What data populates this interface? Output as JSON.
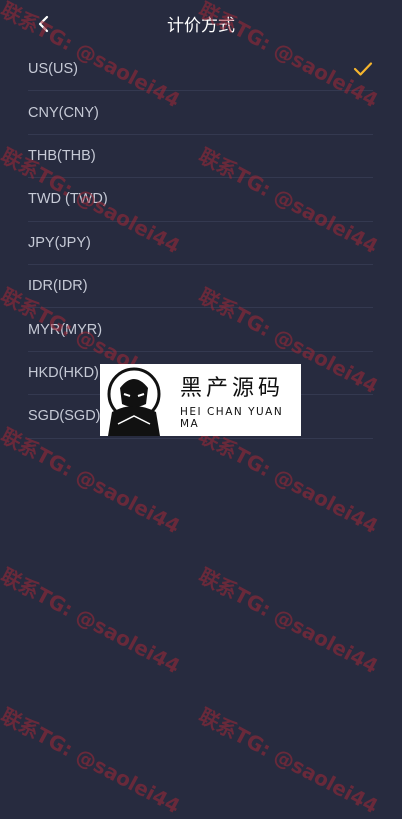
{
  "header": {
    "title": "计价方式"
  },
  "currencies": [
    {
      "label": "US(US)",
      "selected": true
    },
    {
      "label": "CNY(CNY)",
      "selected": false
    },
    {
      "label": "THB(THB)",
      "selected": false
    },
    {
      "label": "TWD (TWD)",
      "selected": false
    },
    {
      "label": "JPY(JPY)",
      "selected": false
    },
    {
      "label": "IDR(IDR)",
      "selected": false
    },
    {
      "label": "MYR(MYR)",
      "selected": false
    },
    {
      "label": "HKD(HKD)",
      "selected": false
    },
    {
      "label": "SGD(SGD)",
      "selected": false
    }
  ],
  "check_icon": "check-icon",
  "accent_color": "#f5b52e",
  "watermark": {
    "text": "联系TG: @saolei44"
  },
  "logo": {
    "title_cn": "黑产源码",
    "title_en": "HEI CHAN YUAN MA"
  }
}
